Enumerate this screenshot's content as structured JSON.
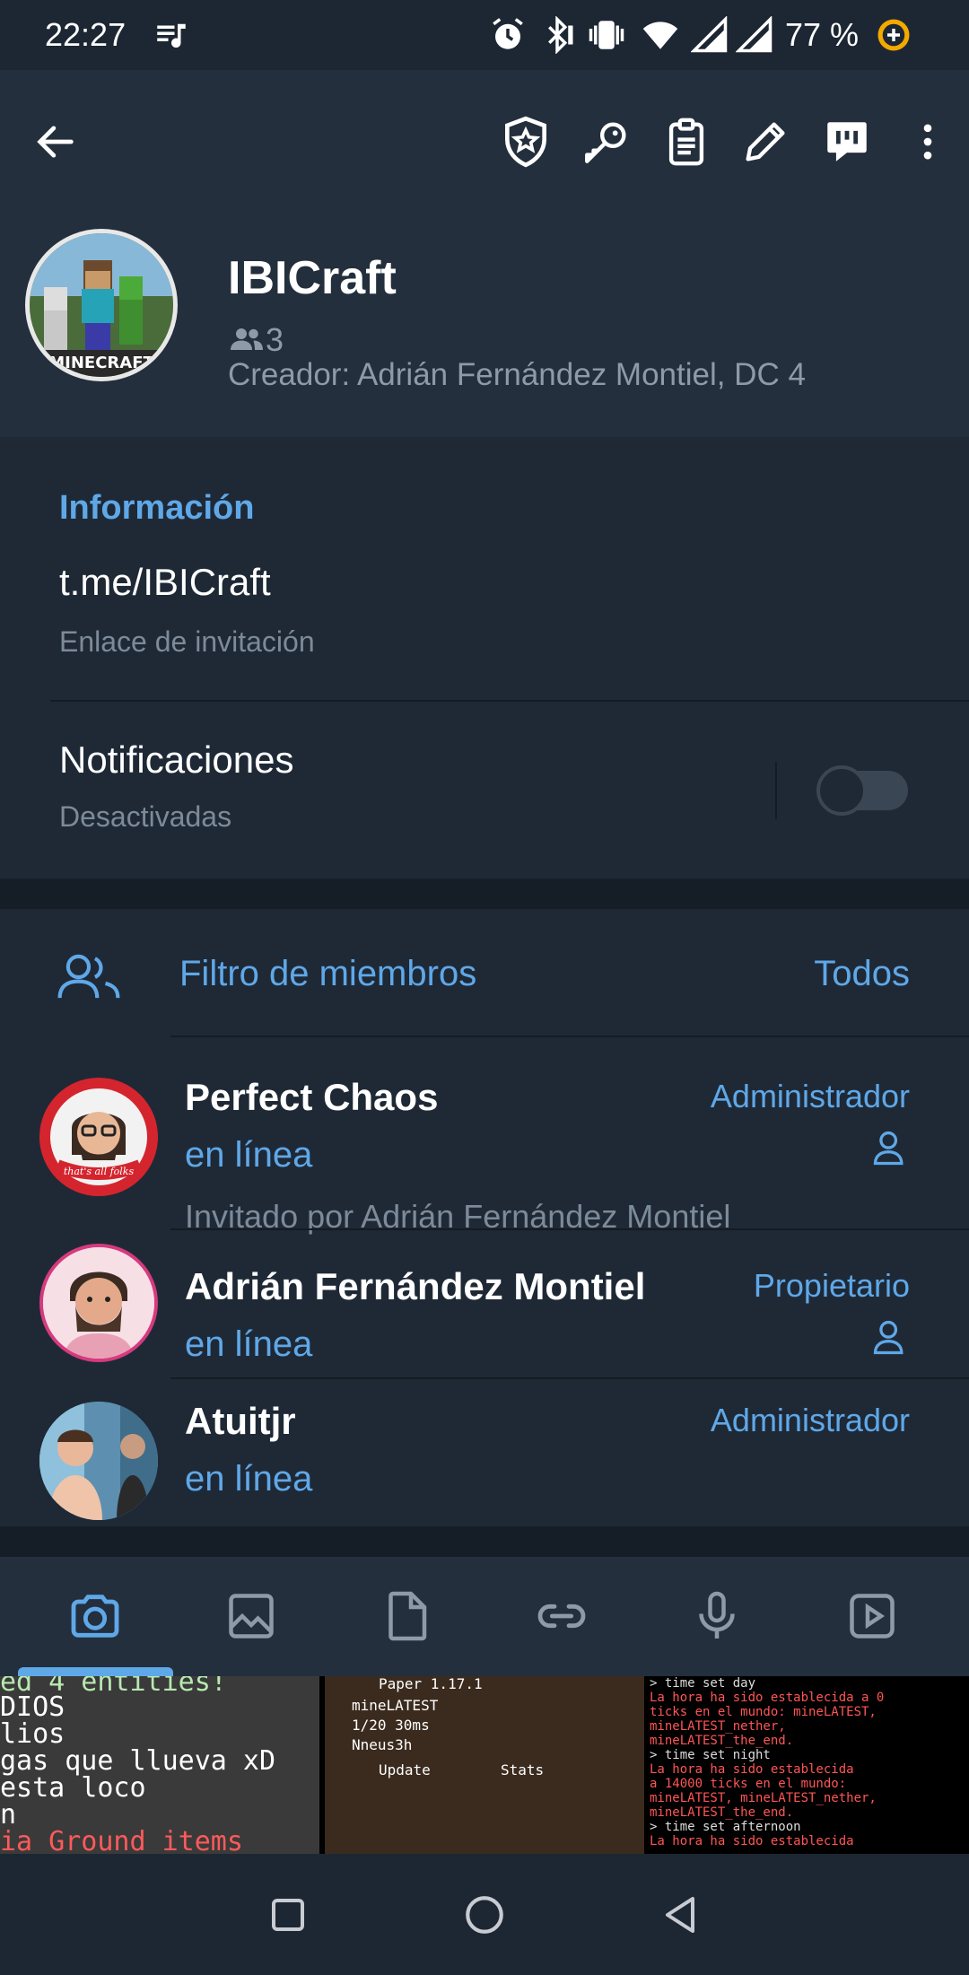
{
  "status_bar": {
    "time": "22:27",
    "battery_percent": "77 %",
    "icons": [
      "music-note-icon",
      "alarm-icon",
      "bluetooth-icon",
      "vibrate-icon",
      "wifi-icon",
      "signal-icon",
      "signal-icon",
      "battery-saver-icon"
    ]
  },
  "toolbar": {
    "icons": [
      "back-arrow-icon",
      "admin-badge-icon",
      "key-icon",
      "clipboard-icon",
      "pencil-icon",
      "poll-icon",
      "more-vertical-icon"
    ]
  },
  "profile": {
    "group_name": "IBICraft",
    "avatar_text": "MINECRAFT",
    "members_count": "3",
    "creator": "Creador: Adrián Fernández Montiel, DC 4"
  },
  "info": {
    "section_title": "Información",
    "link": "t.me/IBICraft",
    "link_subtitle": "Enlace de invitación",
    "notifications_label": "Notificaciones",
    "notifications_status": "Desactivadas",
    "notifications_enabled": false
  },
  "members": {
    "filter_label": "Filtro de miembros",
    "filter_value": "Todos",
    "list": [
      {
        "name": "Perfect Chaos",
        "status": "en línea",
        "role": "Administrador",
        "invited_by": "Invitado por Adrián Fernández Montiel",
        "avatar_caption": "that's all folks"
      },
      {
        "name": "Adrián Fernández Montiel",
        "status": "en línea",
        "role": "Propietario"
      },
      {
        "name": "Atuitjr",
        "status": "en línea",
        "role": "Administrador"
      }
    ]
  },
  "media_tabs": {
    "tabs": [
      "camera-icon",
      "image-icon",
      "file-icon",
      "link-icon",
      "microphone-icon",
      "video-icon"
    ],
    "selected_index": 0
  },
  "media_thumbs": {
    "thumb1": [
      "ed 4 entities!",
      "DIOS",
      "lios",
      "gas que llueva xD",
      "esta loco",
      "n",
      "ia Ground items will be"
    ],
    "thumb2": [
      "Paper 1.17.1",
      "mineLATEST",
      "1/20 30ms",
      "Nneus3h",
      "Update",
      "Stats"
    ],
    "thumb3": [
      "> time set day",
      "La hora ha sido establecida a 0",
      "ticks en el mundo: mineLATEST,",
      "mineLATEST_nether,",
      "mineLATEST_the_end.",
      "> time set night",
      "La hora ha sido establecida",
      "a 14000 ticks en el mundo:",
      "mineLATEST, mineLATEST_nether,",
      "mineLATEST_the_end.",
      "> time set afternoon",
      "La hora ha sido establecida"
    ]
  },
  "nav_bar": {
    "icons": [
      "recents-square-icon",
      "home-circle-icon",
      "back-triangle-icon"
    ]
  },
  "colors": {
    "accent": "#5fa8e8",
    "background": "#1f2936",
    "header": "#242f3d"
  }
}
